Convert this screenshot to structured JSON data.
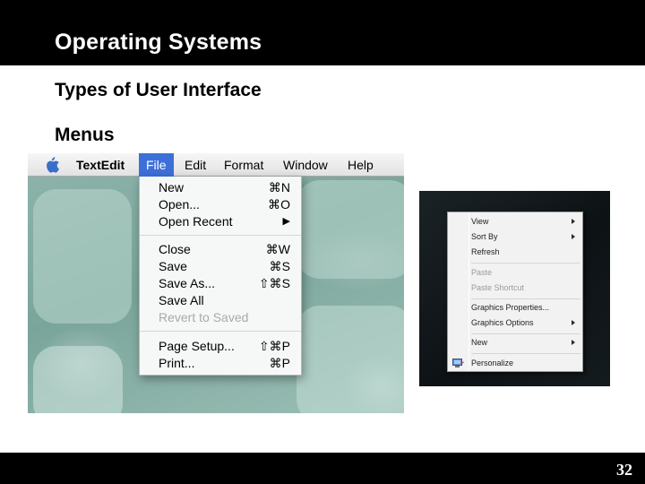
{
  "slide": {
    "title": "Operating Systems",
    "subtitle": "Types of User Interface",
    "section": "Menus",
    "page_number": "32"
  },
  "mac": {
    "menubar": {
      "apple_icon": "apple-logo-icon",
      "items": [
        {
          "label": "TextEdit",
          "state": "app-name"
        },
        {
          "label": "File",
          "state": "active"
        },
        {
          "label": "Edit",
          "state": "normal"
        },
        {
          "label": "Format",
          "state": "normal"
        },
        {
          "label": "Window",
          "state": "normal"
        },
        {
          "label": "Help",
          "state": "normal"
        }
      ]
    },
    "file_menu": {
      "items": [
        {
          "label": "New",
          "shortcut": "⌘N"
        },
        {
          "label": "Open...",
          "shortcut": "⌘O"
        },
        {
          "label": "Open Recent",
          "shortcut": "▶",
          "submenu": true
        },
        {
          "label": "Close",
          "shortcut": "⌘W"
        },
        {
          "label": "Save",
          "shortcut": "⌘S"
        },
        {
          "label": "Save As...",
          "shortcut": "⇧⌘S"
        },
        {
          "label": "Save All",
          "shortcut": ""
        },
        {
          "label": "Revert to Saved",
          "shortcut": "",
          "disabled": true
        },
        {
          "label": "Page Setup...",
          "shortcut": "⇧⌘P"
        },
        {
          "label": "Print...",
          "shortcut": "⌘P"
        }
      ]
    },
    "colors": {
      "highlight": "#3d6fd8",
      "wallpaper": "#8fb5ac"
    }
  },
  "windows": {
    "context_menu": {
      "items": [
        {
          "label": "View",
          "submenu": true
        },
        {
          "label": "Sort By",
          "submenu": true
        },
        {
          "label": "Refresh"
        },
        {
          "label": "Paste",
          "disabled": true
        },
        {
          "label": "Paste Shortcut",
          "disabled": true
        },
        {
          "label": "Graphics Properties..."
        },
        {
          "label": "Graphics Options",
          "submenu": true
        },
        {
          "label": "New",
          "submenu": true
        },
        {
          "label": "Personalize",
          "icon": "personalize-icon"
        }
      ]
    }
  }
}
